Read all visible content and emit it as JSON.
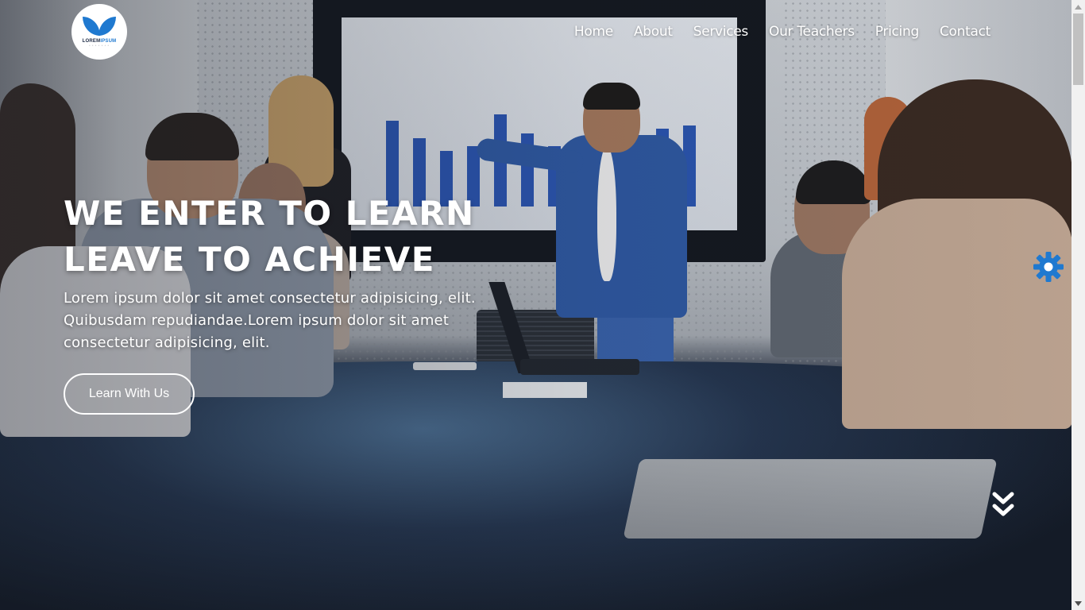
{
  "brand": {
    "name_part1": "LOREM",
    "name_part2": "IPSUM",
    "tagline": "• • • • • • •",
    "accent_color": "#1f79d0"
  },
  "nav": {
    "items": [
      {
        "label": "Home"
      },
      {
        "label": "About"
      },
      {
        "label": "Services"
      },
      {
        "label": "Our Teachers"
      },
      {
        "label": "Pricing"
      },
      {
        "label": "Contact"
      }
    ]
  },
  "hero": {
    "headline_line1": "WE ENTER TO LEARN",
    "headline_line2": "LEAVE TO ACHIEVE",
    "subtext": "Lorem ipsum dolor sit amet consectetur adipisicing, elit. Quibusdam repudiandae.Lorem ipsum dolor sit amet consectetur adipisicing, elit.",
    "cta_label": "Learn With Us"
  },
  "widgets": {
    "settings_icon": "gear-icon",
    "settings_color": "#1f79d0",
    "scroll_icon": "double-chevron-down-icon"
  }
}
